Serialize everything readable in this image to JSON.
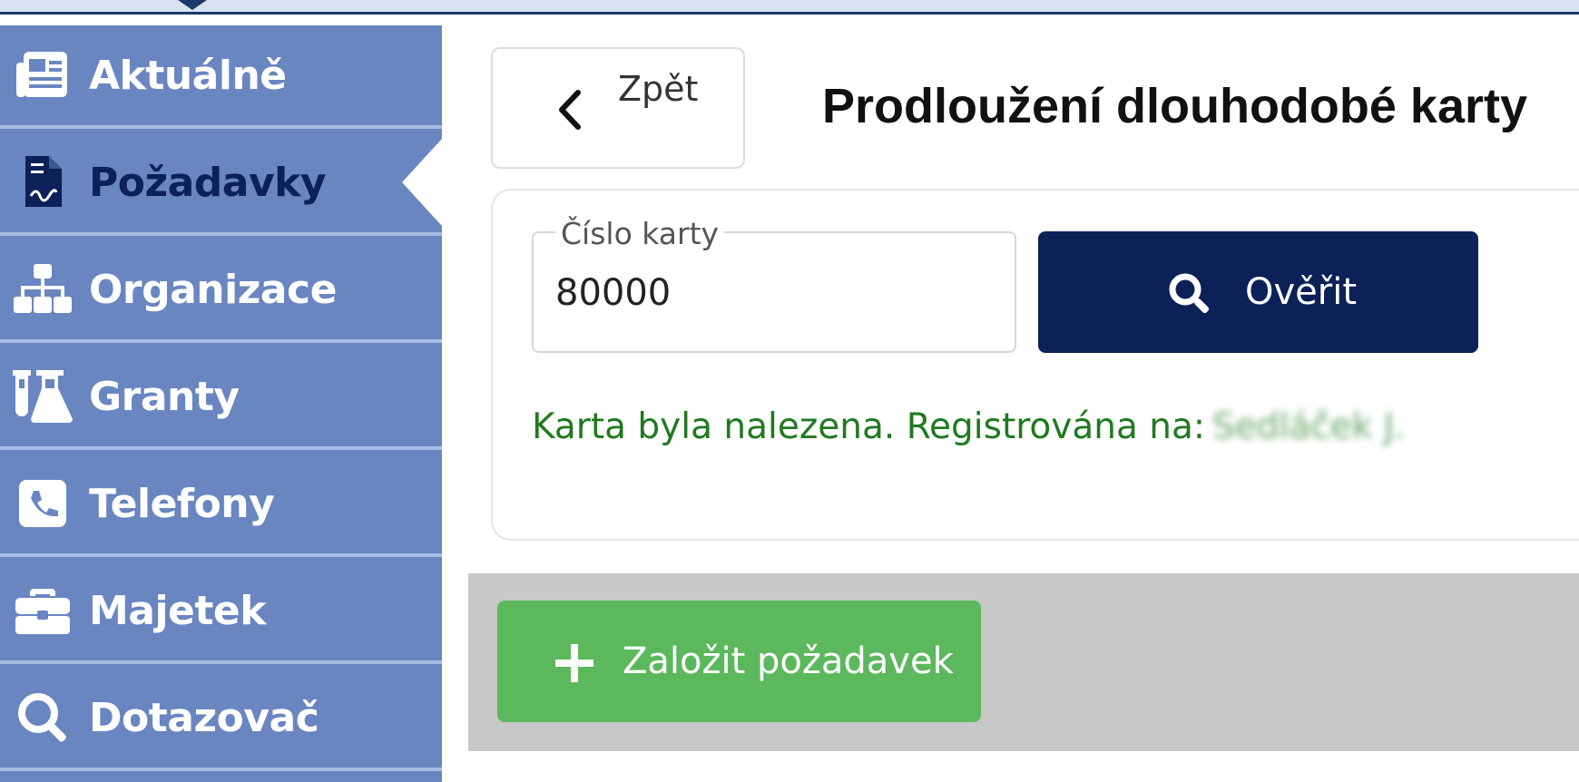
{
  "sidebar": {
    "items": [
      {
        "label": "Aktuálně",
        "icon": "newspaper-icon"
      },
      {
        "label": "Požadavky",
        "icon": "document-icon",
        "active": true
      },
      {
        "label": "Organizace",
        "icon": "org-chart-icon"
      },
      {
        "label": "Granty",
        "icon": "flask-icon"
      },
      {
        "label": "Telefony",
        "icon": "phone-icon"
      },
      {
        "label": "Majetek",
        "icon": "briefcase-icon"
      },
      {
        "label": "Dotazovač",
        "icon": "search-icon"
      }
    ]
  },
  "header": {
    "back_label": "Zpět",
    "title": "Prodloužení dlouhodobé karty"
  },
  "form": {
    "card_number_label": "Číslo karty",
    "card_number_value": "80000",
    "verify_label": "Ověřit",
    "result_message": "Karta byla nalezena. Registrována na:",
    "result_name": "Sedláček J."
  },
  "actions": {
    "create_label": "Založit požadavek"
  },
  "colors": {
    "sidebar_bg": "#6986c1",
    "primary": "#0b2157",
    "success": "#5cb85c",
    "success_text": "#1f7a1f"
  }
}
